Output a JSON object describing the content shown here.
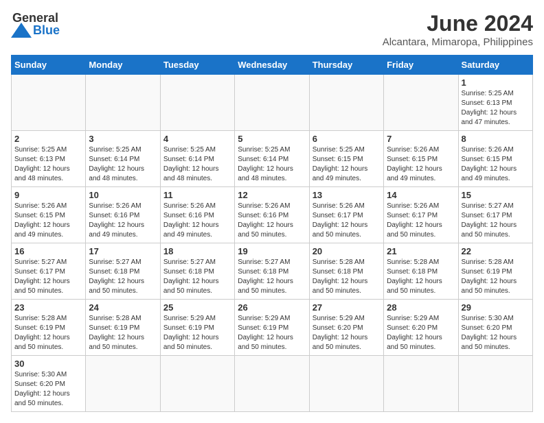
{
  "header": {
    "logo_text_general": "General",
    "logo_text_blue": "Blue",
    "title": "June 2024",
    "subtitle": "Alcantara, Mimaropa, Philippines"
  },
  "weekdays": [
    "Sunday",
    "Monday",
    "Tuesday",
    "Wednesday",
    "Thursday",
    "Friday",
    "Saturday"
  ],
  "weeks": [
    [
      {
        "day": "",
        "info": ""
      },
      {
        "day": "",
        "info": ""
      },
      {
        "day": "",
        "info": ""
      },
      {
        "day": "",
        "info": ""
      },
      {
        "day": "",
        "info": ""
      },
      {
        "day": "",
        "info": ""
      },
      {
        "day": "1",
        "info": "Sunrise: 5:25 AM\nSunset: 6:13 PM\nDaylight: 12 hours and 47 minutes."
      }
    ],
    [
      {
        "day": "2",
        "info": "Sunrise: 5:25 AM\nSunset: 6:13 PM\nDaylight: 12 hours and 48 minutes."
      },
      {
        "day": "3",
        "info": "Sunrise: 5:25 AM\nSunset: 6:14 PM\nDaylight: 12 hours and 48 minutes."
      },
      {
        "day": "4",
        "info": "Sunrise: 5:25 AM\nSunset: 6:14 PM\nDaylight: 12 hours and 48 minutes."
      },
      {
        "day": "5",
        "info": "Sunrise: 5:25 AM\nSunset: 6:14 PM\nDaylight: 12 hours and 48 minutes."
      },
      {
        "day": "6",
        "info": "Sunrise: 5:25 AM\nSunset: 6:15 PM\nDaylight: 12 hours and 49 minutes."
      },
      {
        "day": "7",
        "info": "Sunrise: 5:26 AM\nSunset: 6:15 PM\nDaylight: 12 hours and 49 minutes."
      },
      {
        "day": "8",
        "info": "Sunrise: 5:26 AM\nSunset: 6:15 PM\nDaylight: 12 hours and 49 minutes."
      }
    ],
    [
      {
        "day": "9",
        "info": "Sunrise: 5:26 AM\nSunset: 6:15 PM\nDaylight: 12 hours and 49 minutes."
      },
      {
        "day": "10",
        "info": "Sunrise: 5:26 AM\nSunset: 6:16 PM\nDaylight: 12 hours and 49 minutes."
      },
      {
        "day": "11",
        "info": "Sunrise: 5:26 AM\nSunset: 6:16 PM\nDaylight: 12 hours and 49 minutes."
      },
      {
        "day": "12",
        "info": "Sunrise: 5:26 AM\nSunset: 6:16 PM\nDaylight: 12 hours and 50 minutes."
      },
      {
        "day": "13",
        "info": "Sunrise: 5:26 AM\nSunset: 6:17 PM\nDaylight: 12 hours and 50 minutes."
      },
      {
        "day": "14",
        "info": "Sunrise: 5:26 AM\nSunset: 6:17 PM\nDaylight: 12 hours and 50 minutes."
      },
      {
        "day": "15",
        "info": "Sunrise: 5:27 AM\nSunset: 6:17 PM\nDaylight: 12 hours and 50 minutes."
      }
    ],
    [
      {
        "day": "16",
        "info": "Sunrise: 5:27 AM\nSunset: 6:17 PM\nDaylight: 12 hours and 50 minutes."
      },
      {
        "day": "17",
        "info": "Sunrise: 5:27 AM\nSunset: 6:18 PM\nDaylight: 12 hours and 50 minutes."
      },
      {
        "day": "18",
        "info": "Sunrise: 5:27 AM\nSunset: 6:18 PM\nDaylight: 12 hours and 50 minutes."
      },
      {
        "day": "19",
        "info": "Sunrise: 5:27 AM\nSunset: 6:18 PM\nDaylight: 12 hours and 50 minutes."
      },
      {
        "day": "20",
        "info": "Sunrise: 5:28 AM\nSunset: 6:18 PM\nDaylight: 12 hours and 50 minutes."
      },
      {
        "day": "21",
        "info": "Sunrise: 5:28 AM\nSunset: 6:18 PM\nDaylight: 12 hours and 50 minutes."
      },
      {
        "day": "22",
        "info": "Sunrise: 5:28 AM\nSunset: 6:19 PM\nDaylight: 12 hours and 50 minutes."
      }
    ],
    [
      {
        "day": "23",
        "info": "Sunrise: 5:28 AM\nSunset: 6:19 PM\nDaylight: 12 hours and 50 minutes."
      },
      {
        "day": "24",
        "info": "Sunrise: 5:28 AM\nSunset: 6:19 PM\nDaylight: 12 hours and 50 minutes."
      },
      {
        "day": "25",
        "info": "Sunrise: 5:29 AM\nSunset: 6:19 PM\nDaylight: 12 hours and 50 minutes."
      },
      {
        "day": "26",
        "info": "Sunrise: 5:29 AM\nSunset: 6:19 PM\nDaylight: 12 hours and 50 minutes."
      },
      {
        "day": "27",
        "info": "Sunrise: 5:29 AM\nSunset: 6:20 PM\nDaylight: 12 hours and 50 minutes."
      },
      {
        "day": "28",
        "info": "Sunrise: 5:29 AM\nSunset: 6:20 PM\nDaylight: 12 hours and 50 minutes."
      },
      {
        "day": "29",
        "info": "Sunrise: 5:30 AM\nSunset: 6:20 PM\nDaylight: 12 hours and 50 minutes."
      }
    ],
    [
      {
        "day": "30",
        "info": "Sunrise: 5:30 AM\nSunset: 6:20 PM\nDaylight: 12 hours and 50 minutes."
      },
      {
        "day": "",
        "info": ""
      },
      {
        "day": "",
        "info": ""
      },
      {
        "day": "",
        "info": ""
      },
      {
        "day": "",
        "info": ""
      },
      {
        "day": "",
        "info": ""
      },
      {
        "day": "",
        "info": ""
      }
    ]
  ]
}
